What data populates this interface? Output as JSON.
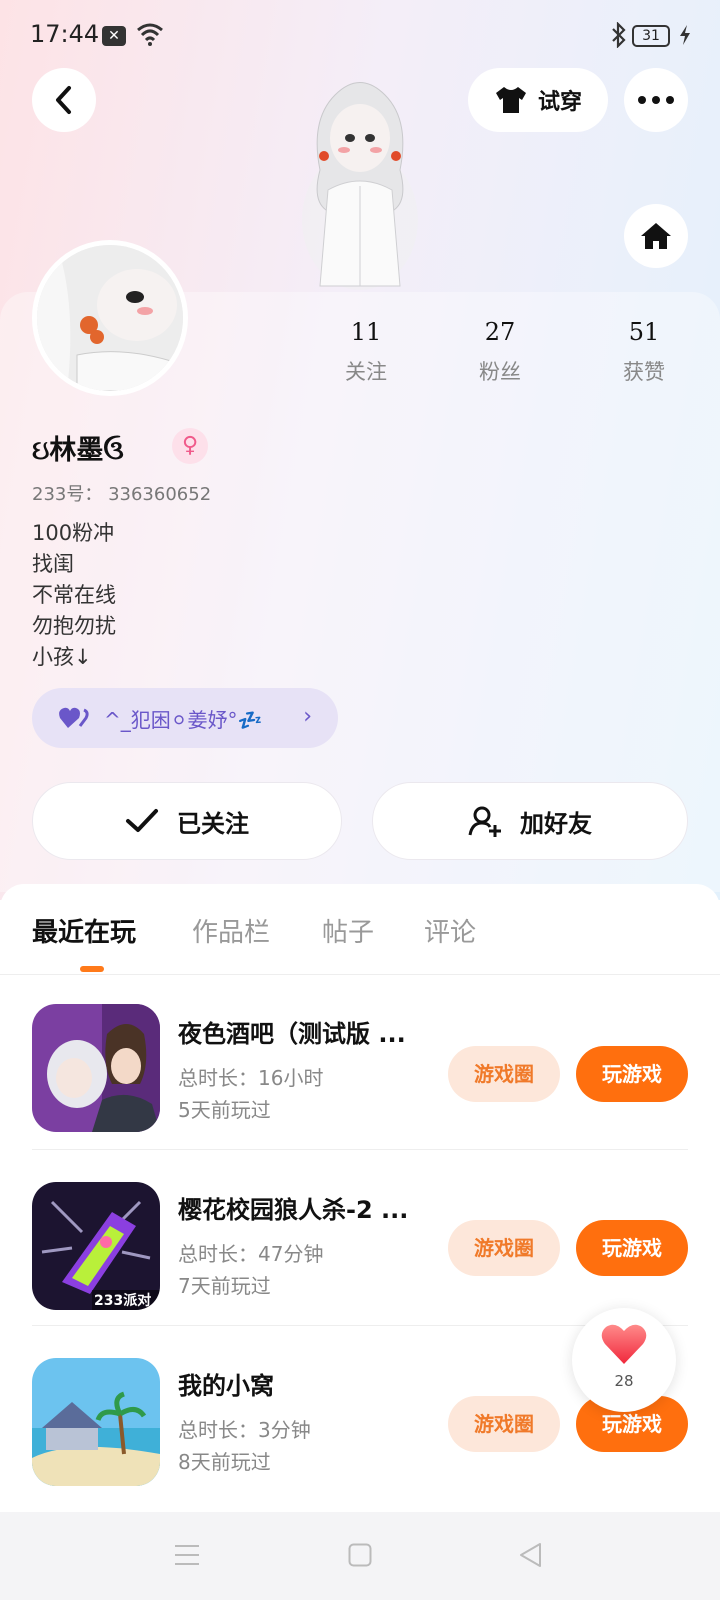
{
  "status_bar": {
    "time": "17:44",
    "battery": "31"
  },
  "header": {
    "tryon_label": "试穿"
  },
  "stats": [
    {
      "value": "11",
      "label": "关注"
    },
    {
      "value": "27",
      "label": "粉丝"
    },
    {
      "value": "51",
      "label": "获赞"
    }
  ],
  "profile": {
    "username": "ઇ林墨ઉ",
    "gender_icon": "♀",
    "uid": "233号：  336360652",
    "bio_lines": [
      "100粉冲",
      "找闺",
      "不常在线",
      "勿抱勿扰",
      "小孩↓"
    ]
  },
  "family": {
    "label": "^_犯困⚪姜妤°💤"
  },
  "actions": {
    "followed_label": "已关注",
    "add_friend_label": "加好友"
  },
  "tabs": [
    {
      "label": "最近在玩",
      "active": true
    },
    {
      "label": "作品栏",
      "active": false
    },
    {
      "label": "帖子",
      "active": false
    },
    {
      "label": "评论",
      "active": false
    }
  ],
  "games": [
    {
      "title": "夜色酒吧（测试版 ...",
      "duration": "总时长：16小时",
      "last_played": "5天前玩过",
      "circle_label": "游戏圈",
      "play_label": "玩游戏"
    },
    {
      "title": "樱花校园狼人杀-2 ...",
      "duration": "总时长：47分钟",
      "last_played": "7天前玩过",
      "circle_label": "游戏圈",
      "play_label": "玩游戏"
    },
    {
      "title": "我的小窝",
      "duration": "总时长：3分钟",
      "last_played": "8天前玩过",
      "circle_label": "游戏圈",
      "play_label": "玩游戏"
    }
  ],
  "game_icon_badge": "233派对",
  "like_float": {
    "count": "28"
  },
  "colors": {
    "accent": "#ff6f0e",
    "accent_soft": "#fde7da",
    "family_bg": "#e7e2f6"
  }
}
